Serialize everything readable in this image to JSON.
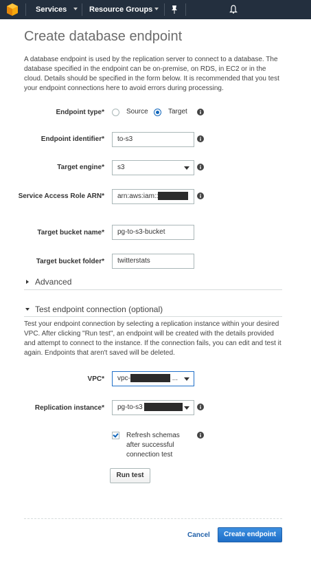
{
  "nav": {
    "services_label": "Services",
    "resource_groups_label": "Resource Groups"
  },
  "page": {
    "title": "Create database endpoint",
    "intro": "A database endpoint is used by the replication server to connect to a database. The database specified in the endpoint can be on-premise, on RDS, in EC2 or in the cloud. Details should be specified in the form below. It is recommended that you test your endpoint connections here to avoid errors during processing."
  },
  "form": {
    "endpoint_type": {
      "label": "Endpoint type*",
      "options": [
        "Source",
        "Target"
      ],
      "selected": "Target"
    },
    "endpoint_identifier": {
      "label": "Endpoint identifier*",
      "value": "to-s3"
    },
    "target_engine": {
      "label": "Target engine*",
      "value": "s3"
    },
    "service_access_role": {
      "label": "Service Access Role ARN*",
      "value": "arn:aws:iam::"
    },
    "target_bucket_name": {
      "label": "Target bucket name*",
      "value": "pg-to-s3-bucket"
    },
    "target_bucket_folder": {
      "label": "Target bucket folder*",
      "value": "twitterstats"
    }
  },
  "advanced": {
    "title": "Advanced"
  },
  "test_connection": {
    "title": "Test endpoint connection (optional)",
    "description": "Test your endpoint connection by selecting a replication instance within your desired VPC. After clicking \"Run test\", an endpoint will be created with the details provided and attempt to connect to the instance. If the connection fails, you can edit and test it again. Endpoints that aren't saved will be deleted.",
    "vpc": {
      "label": "VPC*",
      "value_prefix": "vpc-",
      "value_suffix": "..."
    },
    "replication_instance": {
      "label": "Replication instance*",
      "value_prefix": "pg-to-s3"
    },
    "refresh_schemas": {
      "label": "Refresh schemas after successful connection test",
      "checked": true
    },
    "run_test_label": "Run test"
  },
  "footer": {
    "cancel_label": "Cancel",
    "create_label": "Create endpoint"
  },
  "colors": {
    "nav_bg": "#232f3e",
    "primary": "#1f6fc8",
    "link": "#1f5fa8"
  },
  "icons": [
    "aws-logo-icon",
    "pin-icon",
    "bell-icon",
    "info-icon",
    "chevron-down-icon",
    "chevron-right-icon"
  ]
}
